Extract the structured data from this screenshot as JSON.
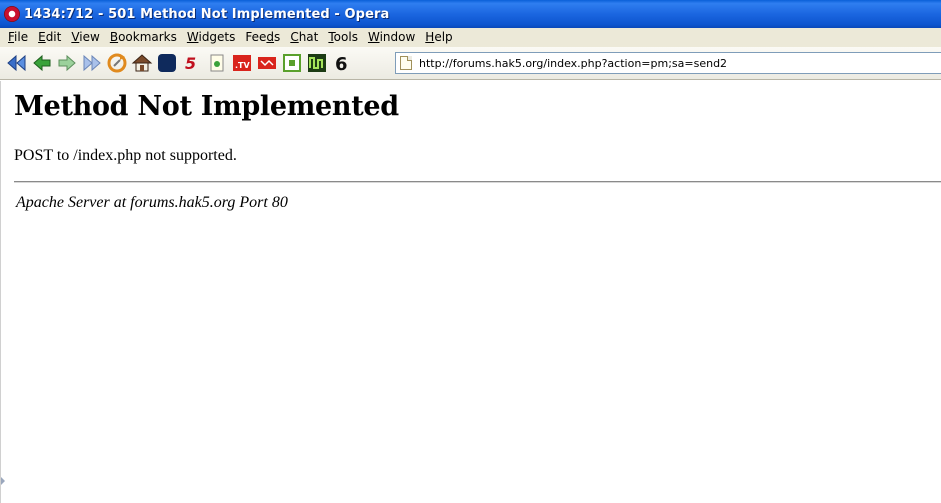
{
  "window": {
    "title": "1434:712 - 501 Method Not Implemented - Opera",
    "app_icon": "opera-icon"
  },
  "menu": {
    "items": [
      {
        "label": "File",
        "accel": "F",
        "rest": "ile"
      },
      {
        "label": "Edit",
        "accel": "E",
        "rest": "dit"
      },
      {
        "label": "View",
        "accel": "V",
        "rest": "iew"
      },
      {
        "label": "Bookmarks",
        "accel": "B",
        "rest": "ookmarks"
      },
      {
        "label": "Widgets",
        "accel": "W",
        "rest": "idgets"
      },
      {
        "label": "Feeds",
        "accel": "d",
        "pre": "Fee",
        "rest": "s"
      },
      {
        "label": "Chat",
        "accel": "C",
        "rest": "hat"
      },
      {
        "label": "Tools",
        "accel": "T",
        "rest": "ools"
      },
      {
        "label": "Window",
        "accel": "W",
        "rest": "indow"
      },
      {
        "label": "Help",
        "accel": "H",
        "rest": "elp"
      }
    ]
  },
  "toolbar": {
    "icons": [
      "rewind-icon",
      "back-icon",
      "forward-icon",
      "fast-forward-icon",
      "reload-icon",
      "home-icon",
      "moon-icon",
      "five-icon",
      "note-icon",
      "tv-icon",
      "stamp-icon",
      "square-icon",
      "chart-icon",
      "six-icon"
    ],
    "url": "http://forums.hak5.org/index.php?action=pm;sa=send2"
  },
  "page": {
    "heading": "Method Not Implemented",
    "message": "POST to /index.php not supported.",
    "signature": "Apache Server at forums.hak5.org Port 80"
  },
  "colors": {
    "titlebar": "#1b66e0",
    "menubar": "#ece9d8"
  }
}
